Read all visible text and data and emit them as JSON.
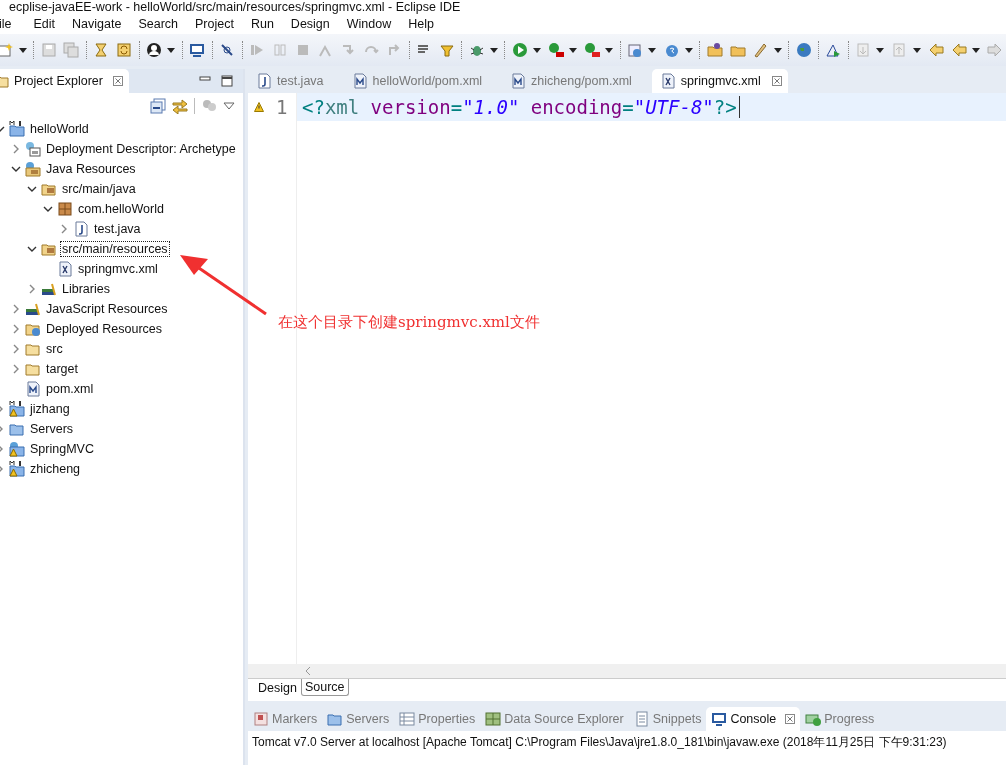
{
  "window": {
    "title": "ecplise-javaEE-work - helloWorld/src/main/resources/springmvc.xml - Eclipse IDE"
  },
  "menu": [
    "ile",
    "Edit",
    "Navigate",
    "Search",
    "Project",
    "Run",
    "Design",
    "Window",
    "Help"
  ],
  "project_explorer": {
    "title": "Project Explorer",
    "tree": [
      {
        "label": "helloWorld",
        "kind": "maven",
        "warning": false,
        "expanded": true,
        "selected": false,
        "children": [
          {
            "label": "Deployment Descriptor: Archetype",
            "kind": "descriptor",
            "expanded": false,
            "selected": false
          },
          {
            "label": "Java Resources",
            "kind": "javares",
            "expanded": true,
            "selected": false,
            "children": [
              {
                "label": "src/main/java",
                "kind": "srcfolder",
                "expanded": true,
                "selected": false,
                "children": [
                  {
                    "label": "com.helloWorld",
                    "kind": "package",
                    "expanded": true,
                    "selected": false,
                    "children": [
                      {
                        "label": "test.java",
                        "kind": "java",
                        "expanded": false,
                        "selected": false
                      }
                    ]
                  }
                ]
              },
              {
                "label": "src/main/resources",
                "kind": "srcfolder",
                "expanded": true,
                "selected": true,
                "children": [
                  {
                    "label": "springmvc.xml",
                    "kind": "xml",
                    "selected": false
                  }
                ]
              },
              {
                "label": "Libraries",
                "kind": "libraries",
                "expanded": false,
                "selected": false
              }
            ]
          },
          {
            "label": "JavaScript Resources",
            "kind": "libraries",
            "expanded": false,
            "selected": false
          },
          {
            "label": "Deployed Resources",
            "kind": "deployed",
            "expanded": false,
            "selected": false
          },
          {
            "label": "src",
            "kind": "folder",
            "expanded": false,
            "selected": false
          },
          {
            "label": "target",
            "kind": "folder",
            "expanded": false,
            "selected": false
          },
          {
            "label": "pom.xml",
            "kind": "pom",
            "selected": false
          }
        ]
      },
      {
        "label": "jizhang",
        "kind": "maven",
        "warning": true,
        "expanded": false,
        "selected": false
      },
      {
        "label": "Servers",
        "kind": "servers",
        "warning": false,
        "expanded": false,
        "selected": false
      },
      {
        "label": "SpringMVC",
        "kind": "web",
        "warning": true,
        "expanded": false,
        "selected": false
      },
      {
        "label": "zhicheng",
        "kind": "maven",
        "warning": true,
        "expanded": false,
        "selected": false
      }
    ]
  },
  "editor_tabs": [
    {
      "label": "test.java",
      "kind": "java",
      "selected": false
    },
    {
      "label": "helloWorld/pom.xml",
      "kind": "pom",
      "selected": false
    },
    {
      "label": "zhicheng/pom.xml",
      "kind": "pom",
      "selected": false
    },
    {
      "label": "springmvc.xml",
      "kind": "xml",
      "selected": true
    }
  ],
  "editor": {
    "lines": [
      {
        "number": "1",
        "warning": true,
        "current": true,
        "tokens": [
          {
            "kind": "punct",
            "text": "<?"
          },
          {
            "kind": "tag",
            "text": "xml"
          },
          {
            "kind": "attr",
            "text": "version"
          },
          {
            "kind": "punct",
            "text": "="
          },
          {
            "kind": "value",
            "text": "\"1.0\""
          },
          {
            "kind": "attr",
            "text": "encoding"
          },
          {
            "kind": "punct",
            "text": "="
          },
          {
            "kind": "value",
            "text": "\"UTF-8\""
          },
          {
            "kind": "punct",
            "text": "?>"
          }
        ]
      }
    ],
    "mode_tabs": [
      {
        "label": "Design",
        "selected": false
      },
      {
        "label": "Source",
        "selected": true
      }
    ]
  },
  "bottom_tabs": [
    {
      "label": "Markers",
      "kind": "markers",
      "selected": false
    },
    {
      "label": "Servers",
      "kind": "servers",
      "selected": false
    },
    {
      "label": "Properties",
      "kind": "properties",
      "selected": false
    },
    {
      "label": "Data Source Explorer",
      "kind": "datasource",
      "selected": false
    },
    {
      "label": "Snippets",
      "kind": "snippets",
      "selected": false
    },
    {
      "label": "Console",
      "kind": "console",
      "selected": true
    },
    {
      "label": "Progress",
      "kind": "progress",
      "selected": false
    }
  ],
  "console": {
    "text": "Tomcat v7.0 Server at localhost [Apache Tomcat] C:\\Program Files\\Java\\jre1.8.0_181\\bin\\javaw.exe (2018年11月25日 下午9:31:23)"
  },
  "annotation": {
    "text": "在这个目录下创建springmvc.xml文件"
  }
}
